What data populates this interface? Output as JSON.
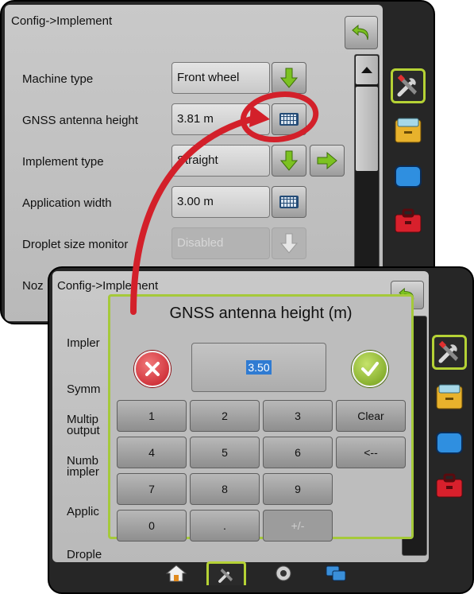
{
  "top_screen": {
    "breadcrumb": "Config->Implement",
    "rows": [
      {
        "label": "Machine type",
        "value": "Front wheel"
      },
      {
        "label": "GNSS antenna height",
        "value": "3.81 m"
      },
      {
        "label": "Implement type",
        "value": "Straight"
      },
      {
        "label": "Application width",
        "value": "3.00 m"
      },
      {
        "label": "Droplet size monitor",
        "value": "Disabled"
      },
      {
        "label": "Noz",
        "value": ""
      }
    ]
  },
  "bottom_screen": {
    "breadcrumb": "Config->Implement",
    "partial_labels": [
      "Impler",
      "Symm",
      "Multip",
      "output",
      "Numb",
      "impler",
      "Applic",
      "Drople"
    ]
  },
  "keypad": {
    "title": "GNSS antenna height (m)",
    "value": "3.50",
    "keys": [
      "1",
      "2",
      "3",
      "Clear",
      "4",
      "5",
      "6",
      "<--",
      "7",
      "8",
      "9",
      "0",
      ".",
      "+/-"
    ]
  },
  "side_tabs": [
    "tools-icon",
    "console-icon",
    "display-icon",
    "toolbox-icon"
  ],
  "bottom_tabs": [
    "home-icon",
    "tools-icon",
    "camera-icon",
    "data-icon"
  ],
  "colors": {
    "accent_green": "#a5c93a",
    "arrow_green": "#7cc221",
    "callout_red": "#d3202a",
    "selection_blue": "#2f7bd2"
  }
}
